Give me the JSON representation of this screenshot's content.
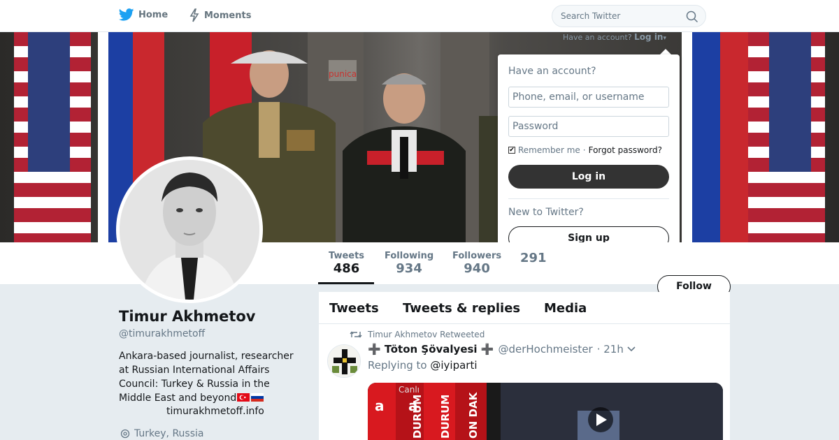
{
  "nav": {
    "home_label": "Home",
    "moments_label": "Moments",
    "search_placeholder": "Search Twitter"
  },
  "account_hint": {
    "text": "Have an account?",
    "login_label": "Log in"
  },
  "login_dropdown": {
    "title": "Have an account?",
    "username_placeholder": "Phone, email, or username",
    "password_placeholder": "Password",
    "remember_label": "Remember me",
    "separator": "·",
    "forgot_label": "Forgot password?",
    "login_button": "Log in",
    "new_label": "New to Twitter?",
    "signup_button": "Sign up"
  },
  "stats": [
    {
      "label": "Tweets",
      "value": "486"
    },
    {
      "label": "Following",
      "value": "934"
    },
    {
      "label": "Followers",
      "value": "940"
    },
    {
      "label": "",
      "value": "291"
    }
  ],
  "follow_button": "Follow",
  "profile": {
    "name": "Timur Akhmetov",
    "handle": "@timurakhmetoff",
    "bio": "Ankara-based journalist, researcher at Russian International Affairs Council: Turkey & Russia in the Middle East and beyond",
    "url": "timurakhmetoff.info",
    "location": "Turkey, Russia"
  },
  "timeline": {
    "tabs": [
      "Tweets",
      "Tweets & replies",
      "Media"
    ],
    "tweet": {
      "retweeted_by": "Timur Akhmetov Retweeted",
      "name": "➕ Töton Şövalyesi ➕",
      "handle": "@derHochmeister",
      "time": "· 21h",
      "replying_to_label": "Replying to",
      "replying_to": "@iyiparti",
      "media_texts": [
        "Canlı",
        "DURUM",
        "DURUM",
        "ON DAK"
      ]
    }
  },
  "colors": {
    "text": "#14171a",
    "muted": "#657786",
    "border": "#e1e8ed",
    "login_button_bg": "#333333",
    "twitter_blue": "#1da1f2"
  }
}
